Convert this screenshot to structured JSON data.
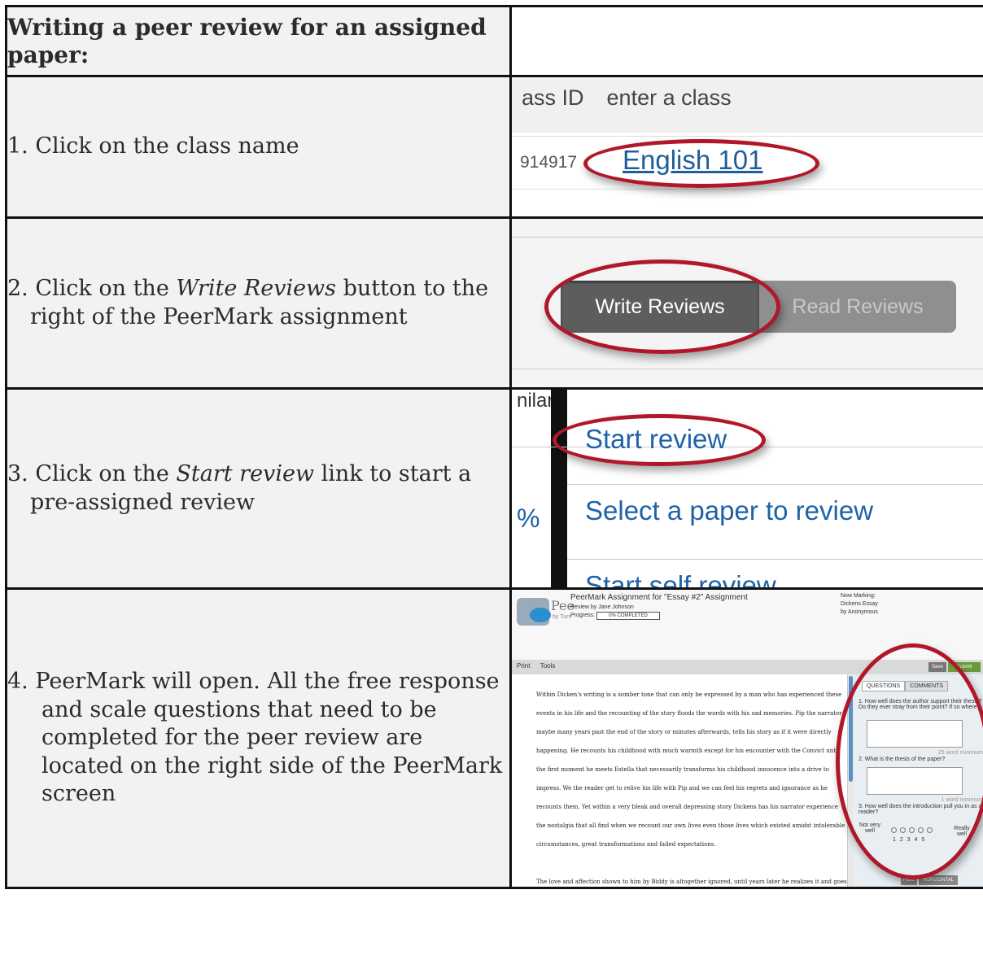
{
  "title": "Writing a peer review for an assigned paper:",
  "steps": [
    {
      "number": "1.",
      "text": "Click on the class name"
    },
    {
      "number": "2.",
      "text_before": "Click on the ",
      "text_em": "Write Reviews",
      "text_after": " button to the right of the PeerMark assignment"
    },
    {
      "number": "3.",
      "text_before": "Click on the ",
      "text_em": "Start review",
      "text_after": " link to start a pre-assigned review"
    },
    {
      "number": "4.",
      "text": "PeerMark will open. All the free response and scale questions that need to be completed for the peer review are located on the right side of the PeerMark screen"
    }
  ],
  "shot1": {
    "header_fragment": "ass ID",
    "header_action": "enter a class",
    "class_id_fragment": "914917",
    "class_link": "English 101"
  },
  "shot2": {
    "write_reviews": "Write Reviews",
    "read_reviews": "Read Reviews"
  },
  "shot3": {
    "top_fragment": "nilar",
    "start_review": "Start review",
    "percent_fragment": "%",
    "select_paper": "Select a paper to review",
    "self_review_fragment": "Start self review"
  },
  "shot4": {
    "assignment_title": "PeerMark Assignment for \"Essay #2\" Assignment",
    "logo_fragment": "Pee",
    "by_fragment": "by Turn",
    "review_by": "Review by Jane Johnson",
    "progress_label": "Progress:",
    "progress_value": "0% COMPLETED",
    "now_marking": "Now Marking:",
    "paper": "Dickens Essay",
    "author": "by Anonymous",
    "menu_print": "Print",
    "menu_tools": "Tools",
    "save": "Save",
    "submit_fragment": "Submit",
    "tab_questions": "QUESTIONS",
    "tab_comments": "COMMENTS",
    "q1": "1. How well does the author support their thesis? Do they ever stray from their point? If so where?",
    "q1_min": "25 word minimum",
    "q2": "2. What is the thesis of the paper?",
    "q2_min": "1 word minimum",
    "q3": "3. How well does the introduction pull you in as a reader?",
    "scale_low": "Not very well",
    "scale_high": "Really well",
    "scale_nums": "1  2  3  4  5",
    "hide": "HIDE",
    "horizontal": "HORIZONTAL",
    "essay_p1": "Within Dicken's writing is a somber tone that can only be expressed by a man who has experienced these events in his life and the recounting of the story floods the words with his sad memories. Pip the narrator maybe many years past the end of the story or minutes afterwards, tells his story as if it were directly happening. He recounts his childhood with much warmth except for his encounter with the Convict until the first moment he meets Estella that necessarily transforms his childhood innocence into a drive to impress. We the reader get to relive his life with Pip and we can feel his regrets and ignorance as he recounts them. Yet within a very bleak and overall depressing story Dickens has his narrator experience the nostalgia that all find when we recount our own lives even those lives which existed amidst intolerable circumstances, great transformations and failed expectations.",
    "essay_p2": "The love and affection shown to him by Biddy is altogether ignored, until years later he realizes it and goes to claim his love only to find out that Joe has married Biddy. Yet it is those memories of Joe and Biddy that are the most pleasant for Pip to recollect. It is mostly the memory of the tiny details that Pip seems to have most affection for. Joe and his ability to comfort Pip by piling gravy on his plate during Christmas dinner is very easily understood now by the narrator Pip. Dickens seems to be commenting on how during our youth the"
  },
  "colors": {
    "ring": "#b0182a",
    "link": "#1f62a8"
  }
}
